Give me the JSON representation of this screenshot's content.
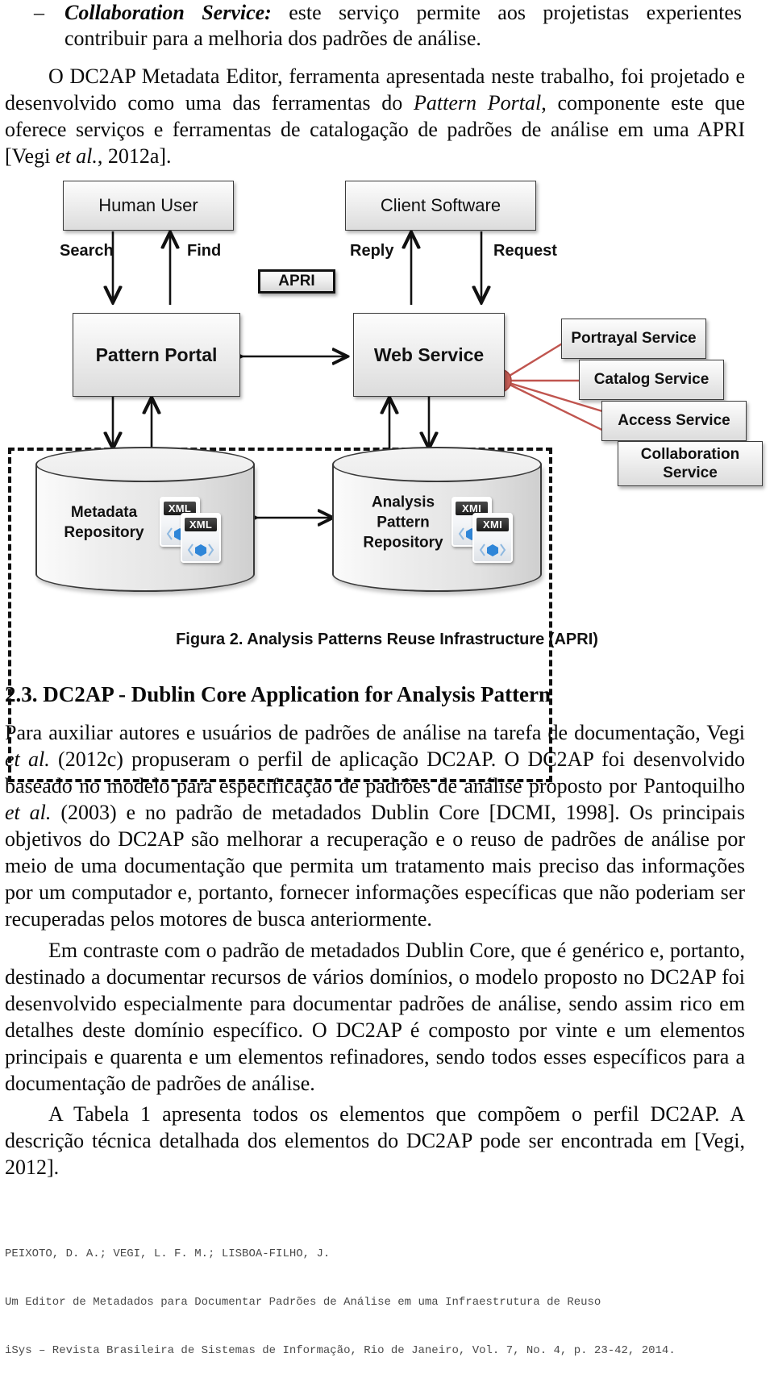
{
  "document": {
    "bullet": {
      "dash": "–",
      "term": "Collaboration Service:",
      "rest": " este serviço permite aos projetistas experientes contribuir para a melhoria dos padrões de análise."
    },
    "paragraphs": {
      "p1_a": "O DC2AP Metadata Editor, ferramenta apresentada neste trabalho, foi projetado e desenvolvido como uma das ferramentas do ",
      "p1_it": "Pattern Portal",
      "p1_b": ", componente este que oferece serviços e ferramentas de catalogação de padrões de análise em uma APRI [Vegi ",
      "p1_it2": "et al.",
      "p1_c": ", 2012a].",
      "p2_a": "Para auxiliar autores e usuários de padrões de análise na tarefa de documentação, Vegi ",
      "p2_it1": "et al.",
      "p2_b": " (2012c) propuseram o perfil de aplicação DC2AP. O DC2AP foi desenvolvido baseado no modelo para especificação de padrões de análise proposto por Pantoquilho ",
      "p2_it2": "et al.",
      "p2_c": " (2003) e no padrão de metadados Dublin Core [DCMI, 1998]. Os principais objetivos do DC2AP são melhorar a recuperação e o reuso de padrões de análise por meio de uma documentação que permita um tratamento mais preciso das informações por um computador e, portanto, fornecer informações específicas que não poderiam ser recuperadas pelos motores de busca anteriormente.",
      "p3": "Em contraste com o padrão de metadados Dublin Core, que é genérico e, portanto, destinado a documentar recursos de vários domínios, o modelo proposto no DC2AP foi desenvolvido especialmente para documentar padrões de análise, sendo assim rico em detalhes deste domínio específico. O DC2AP é composto por vinte e um elementos principais e quarenta e um elementos refinadores, sendo todos esses específicos para a documentação de padrões de análise.",
      "p4": "A Tabela 1 apresenta todos os elementos que compõem o perfil DC2AP. A descrição técnica detalhada dos elementos do DC2AP pode ser encontrada em [Vegi, 2012]."
    },
    "section_heading": "2.3. DC2AP - Dublin Core Application for Analysis Pattern",
    "figure_caption": "Figura 2. Analysis Patterns Reuse Infrastructure (APRI)",
    "footer": {
      "line1": "PEIXOTO, D. A.; VEGI, L. F. M.; LISBOA-FILHO, J.",
      "line2": "Um Editor de Metadados para Documentar Padrões de Análise em uma Infraestrutura de Reuso",
      "line3": "iSys – Revista Brasileira de Sistemas de Informação, Rio de Janeiro, Vol. 7, No. 4, p. 23-42, 2014."
    }
  },
  "figure": {
    "nodes": {
      "human_user": "Human User",
      "client_software": "Client Software",
      "apri": "APRI",
      "pattern_portal": "Pattern Portal",
      "web_service": "Web Service",
      "metadata_repository": "Metadata\nRepository",
      "analysis_pattern_repository": "Analysis\nPattern\nRepository"
    },
    "services": [
      {
        "label": "Portrayal Service"
      },
      {
        "label": "Catalog Service"
      },
      {
        "label": "Access Service"
      },
      {
        "label": "Collaboration Service"
      }
    ],
    "flow_labels": {
      "search": "Search",
      "find": "Find",
      "reply": "Reply",
      "request": "Request"
    },
    "file_icons": {
      "xml": "XML",
      "xmi": "XMI"
    },
    "colors": {
      "connector_red": "#c0554f",
      "node_border": "#3c3c3c",
      "dashed_border": "#111111",
      "gem_blue": "#1f7fd4"
    }
  }
}
